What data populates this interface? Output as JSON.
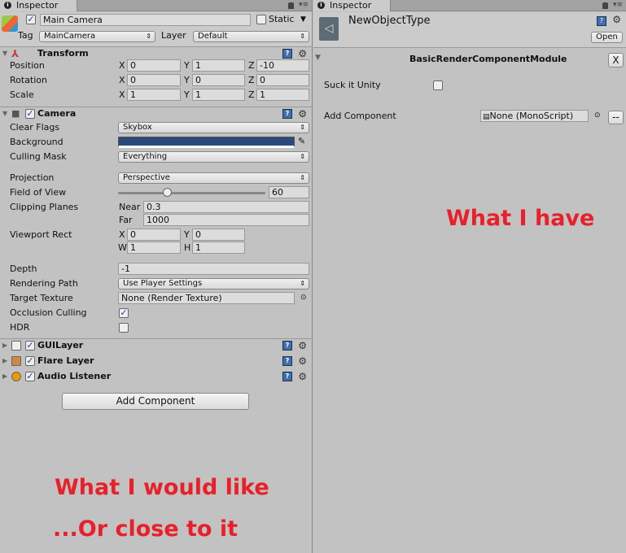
{
  "left": {
    "tab": "Inspector",
    "object_name": "Main Camera",
    "active": true,
    "static_label": "Static",
    "static": false,
    "tag_label": "Tag",
    "tag": "MainCamera",
    "layer_label": "Layer",
    "layer": "Default",
    "transform": {
      "title": "Transform",
      "rows": [
        {
          "label": "Position",
          "x": "0",
          "y": "1",
          "z": "-10"
        },
        {
          "label": "Rotation",
          "x": "0",
          "y": "0",
          "z": "0"
        },
        {
          "label": "Scale",
          "x": "1",
          "y": "1",
          "z": "1"
        }
      ]
    },
    "axis": {
      "x": "X",
      "y": "Y",
      "z": "Z",
      "w": "W",
      "h": "H"
    },
    "camera": {
      "title": "Camera",
      "clear_flags_label": "Clear Flags",
      "clear_flags": "Skybox",
      "background_label": "Background",
      "background_color": "#2a4a7a",
      "culling_mask_label": "Culling Mask",
      "culling_mask": "Everything",
      "projection_label": "Projection",
      "projection": "Perspective",
      "fov_label": "Field of View",
      "fov": "60",
      "clipping_label": "Clipping Planes",
      "near_label": "Near",
      "near": "0.3",
      "far_label": "Far",
      "far": "1000",
      "viewport_label": "Viewport Rect",
      "vx": "0",
      "vy": "0",
      "vw": "1",
      "vh": "1",
      "depth_label": "Depth",
      "depth": "-1",
      "rendering_path_label": "Rendering Path",
      "rendering_path": "Use Player Settings",
      "target_texture_label": "Target Texture",
      "target_texture": "None (Render Texture)",
      "occlusion_label": "Occlusion Culling",
      "occlusion": true,
      "hdr_label": "HDR",
      "hdr": false
    },
    "components": [
      {
        "title": "GUILayer"
      },
      {
        "title": "Flare Layer"
      },
      {
        "title": "Audio Listener"
      }
    ],
    "add_component": "Add Component",
    "caption1": "What I would like",
    "caption2": "...Or close to it"
  },
  "right": {
    "tab": "Inspector",
    "object_name": "NewObjectType",
    "open": "Open",
    "module_title": "BasicRenderComponentModule",
    "close": "X",
    "suck_label": "Suck it Unity",
    "suck": false,
    "add_component_label": "Add Component",
    "add_component_value": "None (MonoScript)",
    "more": "--",
    "caption": "What I have"
  }
}
